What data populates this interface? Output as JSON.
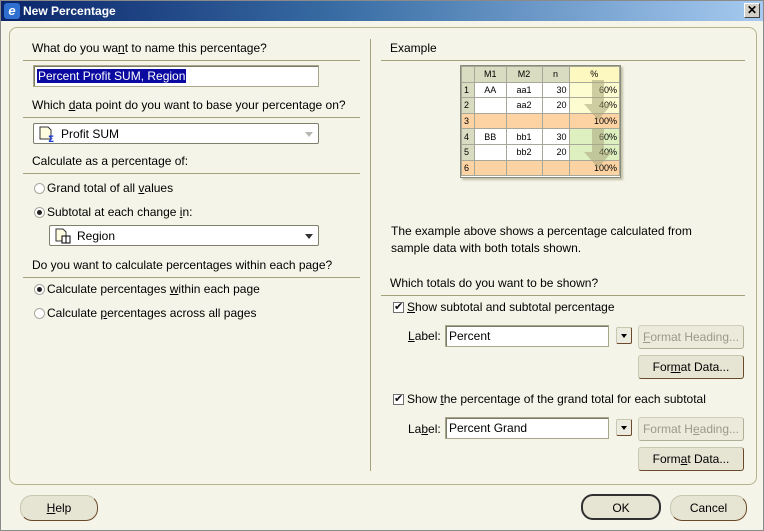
{
  "window": {
    "title": "New Percentage",
    "icon": "app-ie-icon",
    "close_label": "✕"
  },
  "left": {
    "name_question": {
      "before": "What do you wa",
      "mn": "n",
      "after": "t to name this percentage?"
    },
    "name_value": "Percent Profit SUM, Region",
    "datapoint_question": {
      "before": "Which ",
      "mn": "d",
      "after": "ata point do you want to base your percentage on?"
    },
    "datapoint_value": "Profit SUM",
    "calc_question": "Calculate as a percentage of:",
    "grand_total": {
      "before": "Grand total of all ",
      "mn": "v",
      "after": "alues",
      "checked": false
    },
    "subtotal": {
      "before": "Subtotal at each change ",
      "mn": "i",
      "after": "n:",
      "checked": true
    },
    "subtotal_value": "Region",
    "page_question": "Do you want to calculate percentages within each page?",
    "within_page": {
      "before": "Calculate percentages ",
      "mn": "w",
      "after": "ithin each page",
      "checked": true
    },
    "across_pages": {
      "before": "Calculate ",
      "mn": "p",
      "after": "ercentages across all pages",
      "checked": false
    }
  },
  "right": {
    "example_heading": "Example",
    "example_table": {
      "headers": [
        "",
        "M1",
        "M2",
        "n",
        "%"
      ],
      "rows": [
        [
          "1",
          "AA",
          "aa1",
          "30",
          "60%"
        ],
        [
          "2",
          "",
          "aa2",
          "20",
          "40%"
        ],
        [
          "3",
          "",
          "",
          "",
          "100%"
        ],
        [
          "4",
          "BB",
          "bb1",
          "30",
          "60%"
        ],
        [
          "5",
          "",
          "bb2",
          "20",
          "40%"
        ],
        [
          "6",
          "",
          "",
          "",
          "100%"
        ]
      ]
    },
    "description_line1": "The example above shows a percentage calculated from",
    "description_line2": "sample data with both totals shown.",
    "totals_question": "Which totals do you want to be shown?",
    "show_subtotal": {
      "before": "",
      "mn": "S",
      "after": "how subtotal and subtotal percentage",
      "checked": true
    },
    "label1": {
      "before": "",
      "mn": "L",
      "after": "abel:",
      "value": "Percent"
    },
    "format_heading1": {
      "before": "",
      "mn": "F",
      "after": "ormat Heading..."
    },
    "format_data1": {
      "before": "For",
      "mn": "m",
      "after": "at Data..."
    },
    "show_grand": {
      "before": "Show ",
      "mn": "t",
      "after": "he percentage of the grand total for each subtotal",
      "checked": true
    },
    "label2": {
      "before": "La",
      "mn": "b",
      "after": "el:",
      "value": "Percent Grand"
    },
    "format_heading2": {
      "before": "Format H",
      "mn": "e",
      "after": "ading..."
    },
    "format_data2": {
      "before": "Form",
      "mn": "a",
      "after": "t Data..."
    }
  },
  "footer": {
    "help": {
      "before": "",
      "mn": "H",
      "after": "elp"
    },
    "ok": "OK",
    "cancel": "Cancel"
  }
}
